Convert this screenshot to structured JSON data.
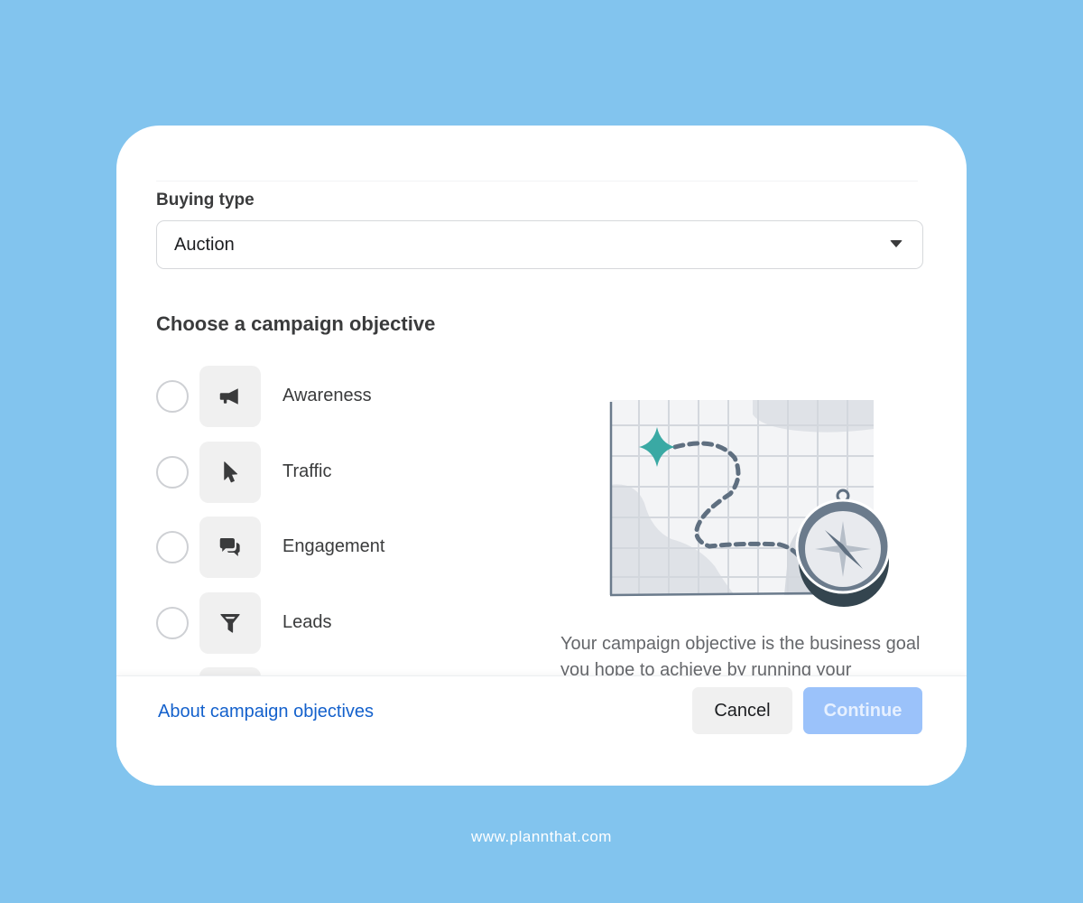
{
  "form": {
    "buying_type_label": "Buying type",
    "buying_type_value": "Auction",
    "objective_title": "Choose a campaign objective",
    "objectives": [
      {
        "label": "Awareness",
        "icon": "megaphone-icon",
        "selected": false
      },
      {
        "label": "Traffic",
        "icon": "cursor-icon",
        "selected": false
      },
      {
        "label": "Engagement",
        "icon": "chat-bubbles-icon",
        "selected": false
      },
      {
        "label": "Leads",
        "icon": "funnel-icon",
        "selected": false
      }
    ],
    "description": "Your campaign objective is the business goal you hope to achieve by running your"
  },
  "footer": {
    "help_link": "About campaign objectives",
    "cancel_label": "Cancel",
    "continue_label": "Continue"
  },
  "colors": {
    "background": "#82c4ee",
    "link": "#1461cc",
    "continue_disabled": "#9bc2fa",
    "accent_star": "#3aa9a4"
  },
  "watermark": "www.plannthat.com"
}
